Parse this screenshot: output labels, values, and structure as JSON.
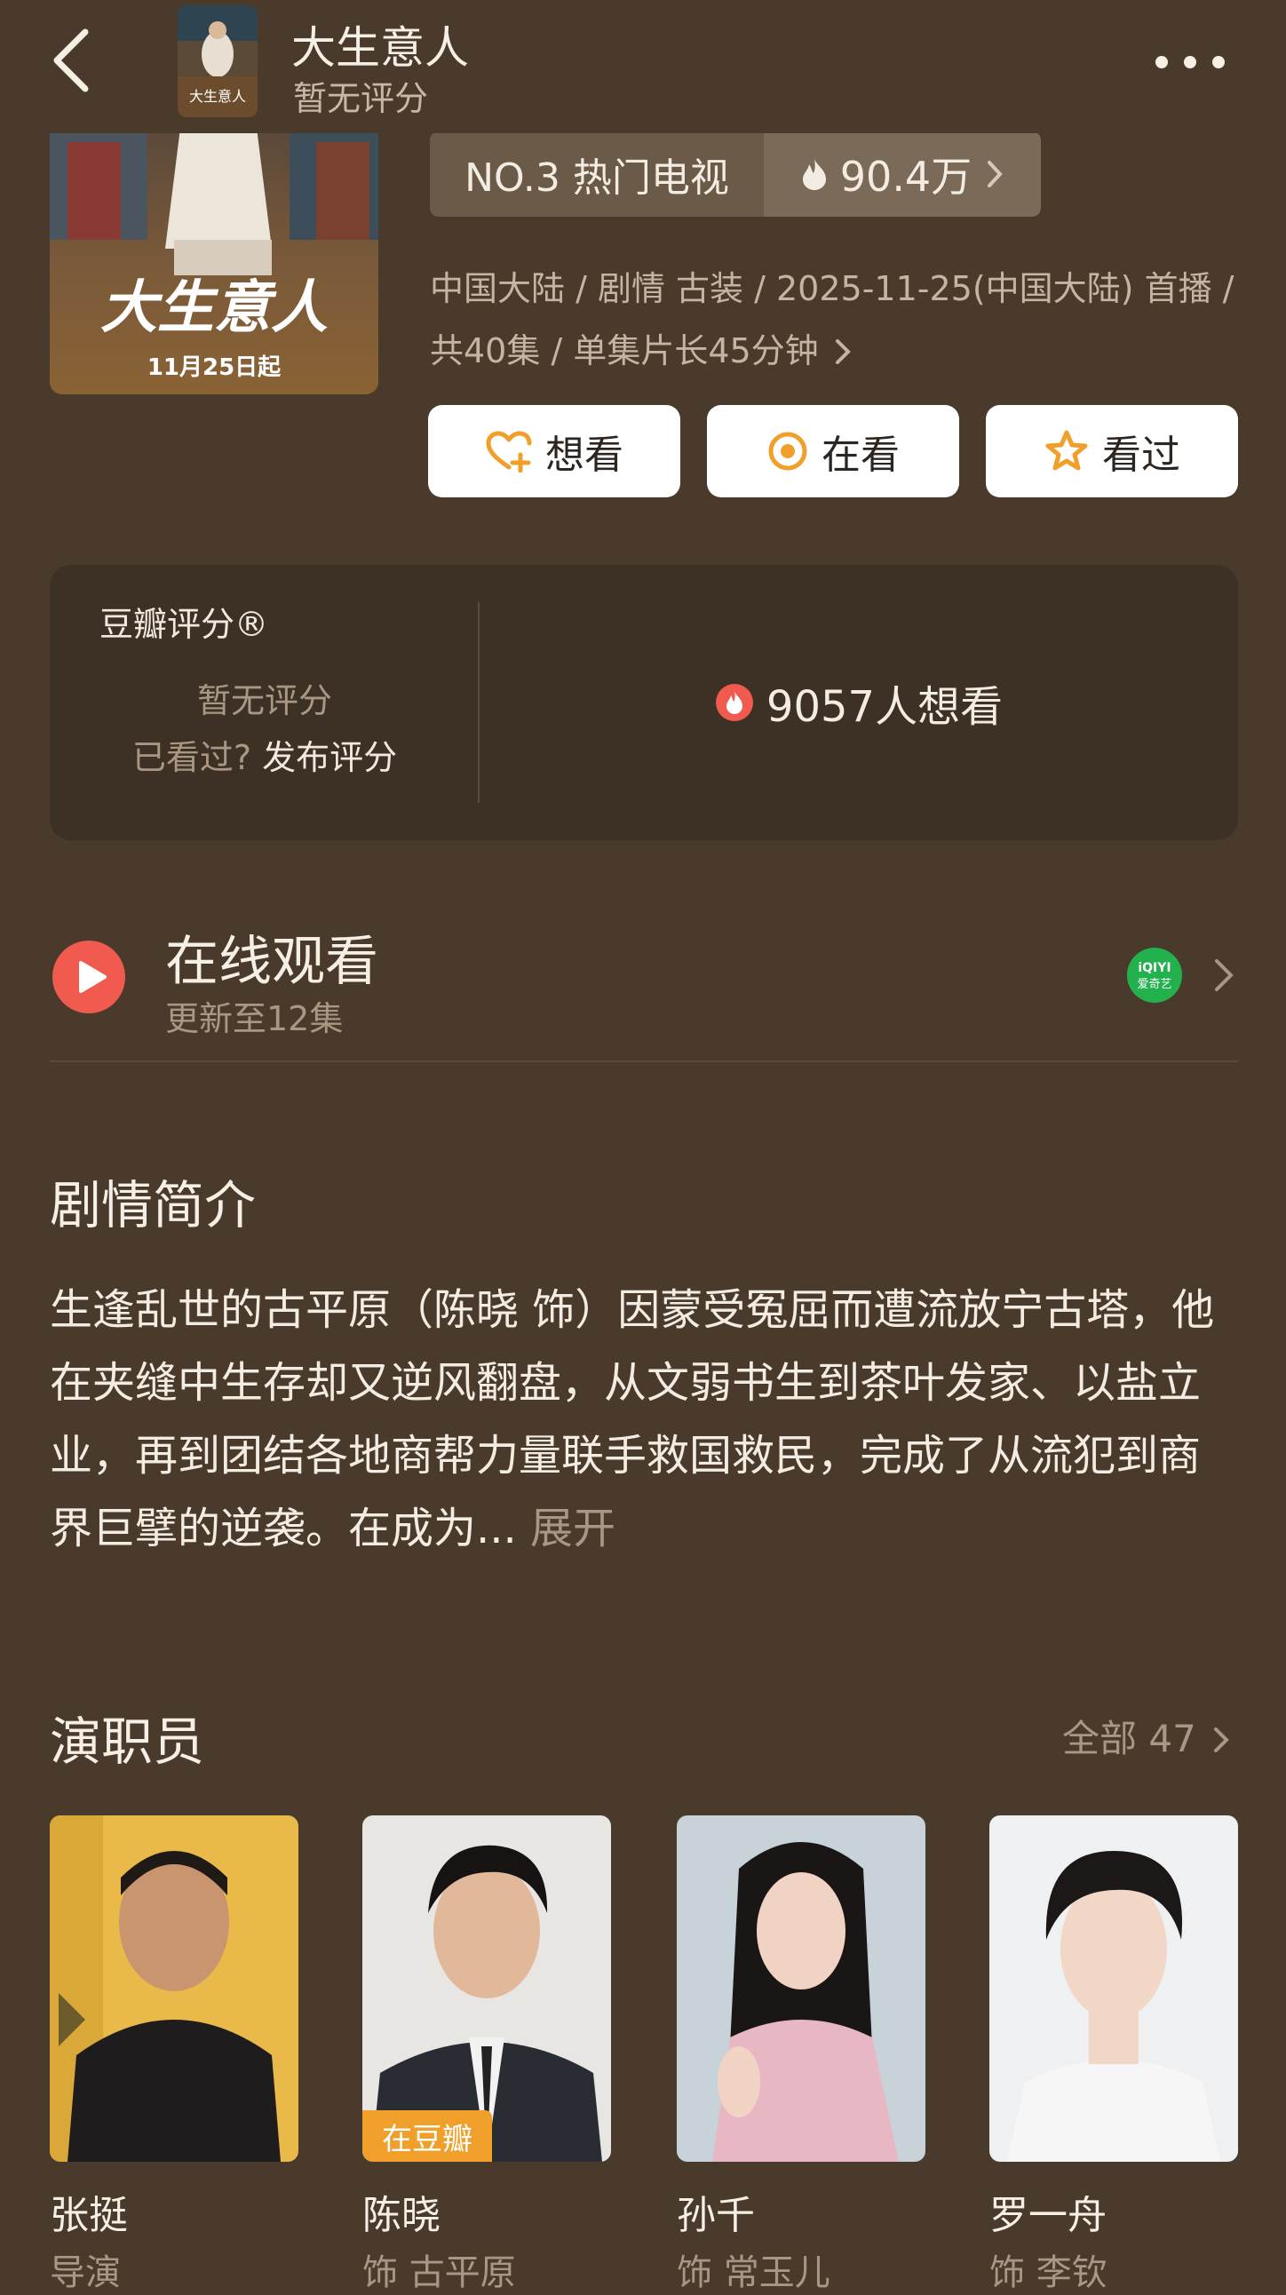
{
  "header": {
    "title": "大生意人",
    "subtitle": "暂无评分",
    "back_icon": "chevron-left-icon",
    "more_icon": "more-dots-icon"
  },
  "poster": {
    "title_art": "大生意人",
    "date_art": "11月25日起"
  },
  "rank": {
    "label": "NO.3 热门电视",
    "heat": "90.4万",
    "icon": "fire-icon"
  },
  "meta": {
    "line": "中国大陆 / 剧情 古装 / 2025-11-25(中国大陆) 首播 / 共40集 / 单集片长45分钟"
  },
  "actions": {
    "want": "想看",
    "watching": "在看",
    "watched": "看过"
  },
  "rating": {
    "label": "豆瓣评分®",
    "none": "暂无评分",
    "seen_prompt": "已看过?",
    "publish": "发布评分",
    "want_count": "9057人想看"
  },
  "online": {
    "title": "在线观看",
    "update": "更新至12集",
    "platform_logo_text": "iQIYI 爱奇艺"
  },
  "synopsis": {
    "heading": "剧情简介",
    "text": "生逢乱世的古平原（陈晓 饰）因蒙受冤屈而遭流放宁古塔，他在夹缝中生存却又逆风翻盘，从文弱书生到茶叶发家、以盐立业，再到团结各地商帮力量联手救国救民，完成了从流犯到商界巨擘的逆袭。在成为...",
    "expand": "展开"
  },
  "cast": {
    "heading": "演职员",
    "all_label": "全部 47",
    "badge": "在豆瓣",
    "members": [
      {
        "name": "张挺",
        "role": "导演"
      },
      {
        "name": "陈晓",
        "role": "饰 古平原"
      },
      {
        "name": "孙千",
        "role": "饰 常玉儿"
      },
      {
        "name": "罗一舟",
        "role": "饰 李钦"
      }
    ]
  },
  "colors": {
    "background": "#4a3a2b",
    "card": "#3d3024",
    "accent_orange": "#f0a02a",
    "play_red": "#f05a4f"
  }
}
